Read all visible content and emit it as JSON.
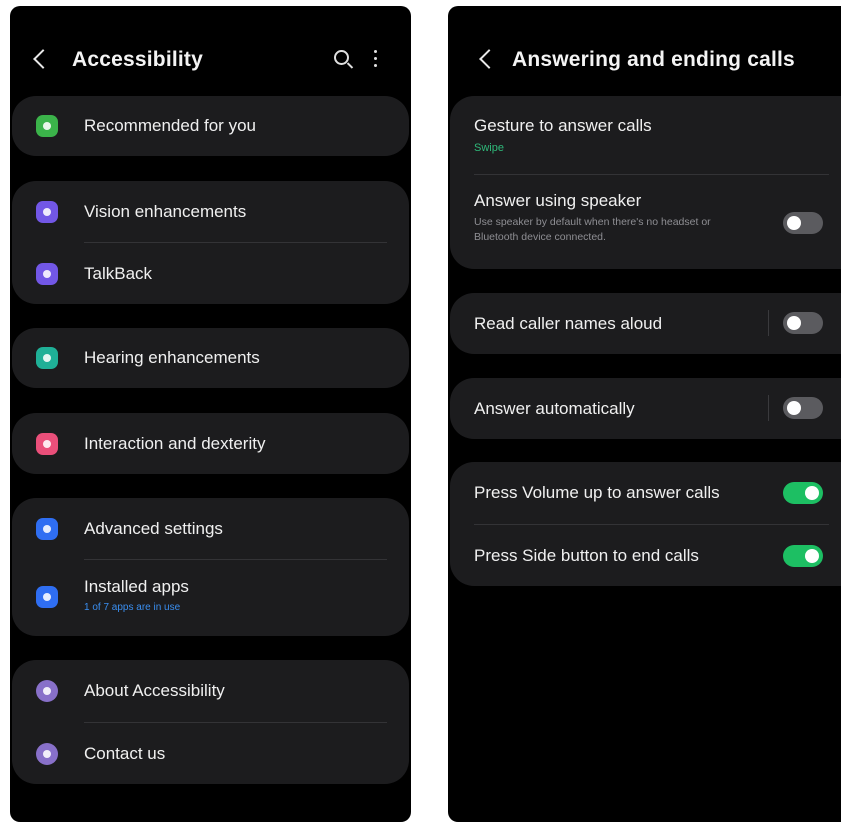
{
  "left": {
    "title": "Accessibility",
    "icons": {
      "back": "back-arrow-icon",
      "search": "search-icon",
      "more": "more-options-icon"
    },
    "items": [
      {
        "label": "Recommended for you",
        "icon": "accessibility-person-icon",
        "color": "#3bb34a"
      },
      {
        "label": "Vision enhancements",
        "icon": "vision-magnifier-icon",
        "color": "#7257e6"
      },
      {
        "label": "TalkBack",
        "icon": "talkback-icon",
        "color": "#7257e6"
      },
      {
        "label": "Hearing enhancements",
        "icon": "hearing-speaker-icon",
        "color": "#1fb097"
      },
      {
        "label": "Interaction and dexterity",
        "icon": "hand-touch-icon",
        "color": "#ea4f7a"
      },
      {
        "label": "Advanced settings",
        "icon": "settings-gear-icon",
        "color": "#2f6ef2"
      },
      {
        "label": "Installed apps",
        "sub": "1 of 7 apps are in use",
        "icon": "apps-icon",
        "color": "#2f6ef2"
      },
      {
        "label": "About Accessibility",
        "icon": "info-icon",
        "color": "#8870c9"
      },
      {
        "label": "Contact us",
        "icon": "help-question-icon",
        "color": "#8870c9"
      }
    ]
  },
  "right": {
    "title": "Answering and ending calls",
    "gesture": {
      "label": "Gesture to answer calls",
      "value": "Swipe"
    },
    "speaker": {
      "label": "Answer using speaker",
      "desc": "Use speaker by default when there's no headset or Bluetooth device connected.",
      "on": false
    },
    "read_names": {
      "label": "Read caller names aloud",
      "on": false
    },
    "auto_answer": {
      "label": "Answer automatically",
      "on": false
    },
    "volume_up": {
      "label": "Press Volume up to answer calls",
      "on": true
    },
    "side_button": {
      "label": "Press Side button to end calls",
      "on": true
    },
    "colors": {
      "toggle_on": "#1dbf63",
      "toggle_off": "#5b5b5f",
      "accent_sub": "#2fb97a"
    }
  }
}
